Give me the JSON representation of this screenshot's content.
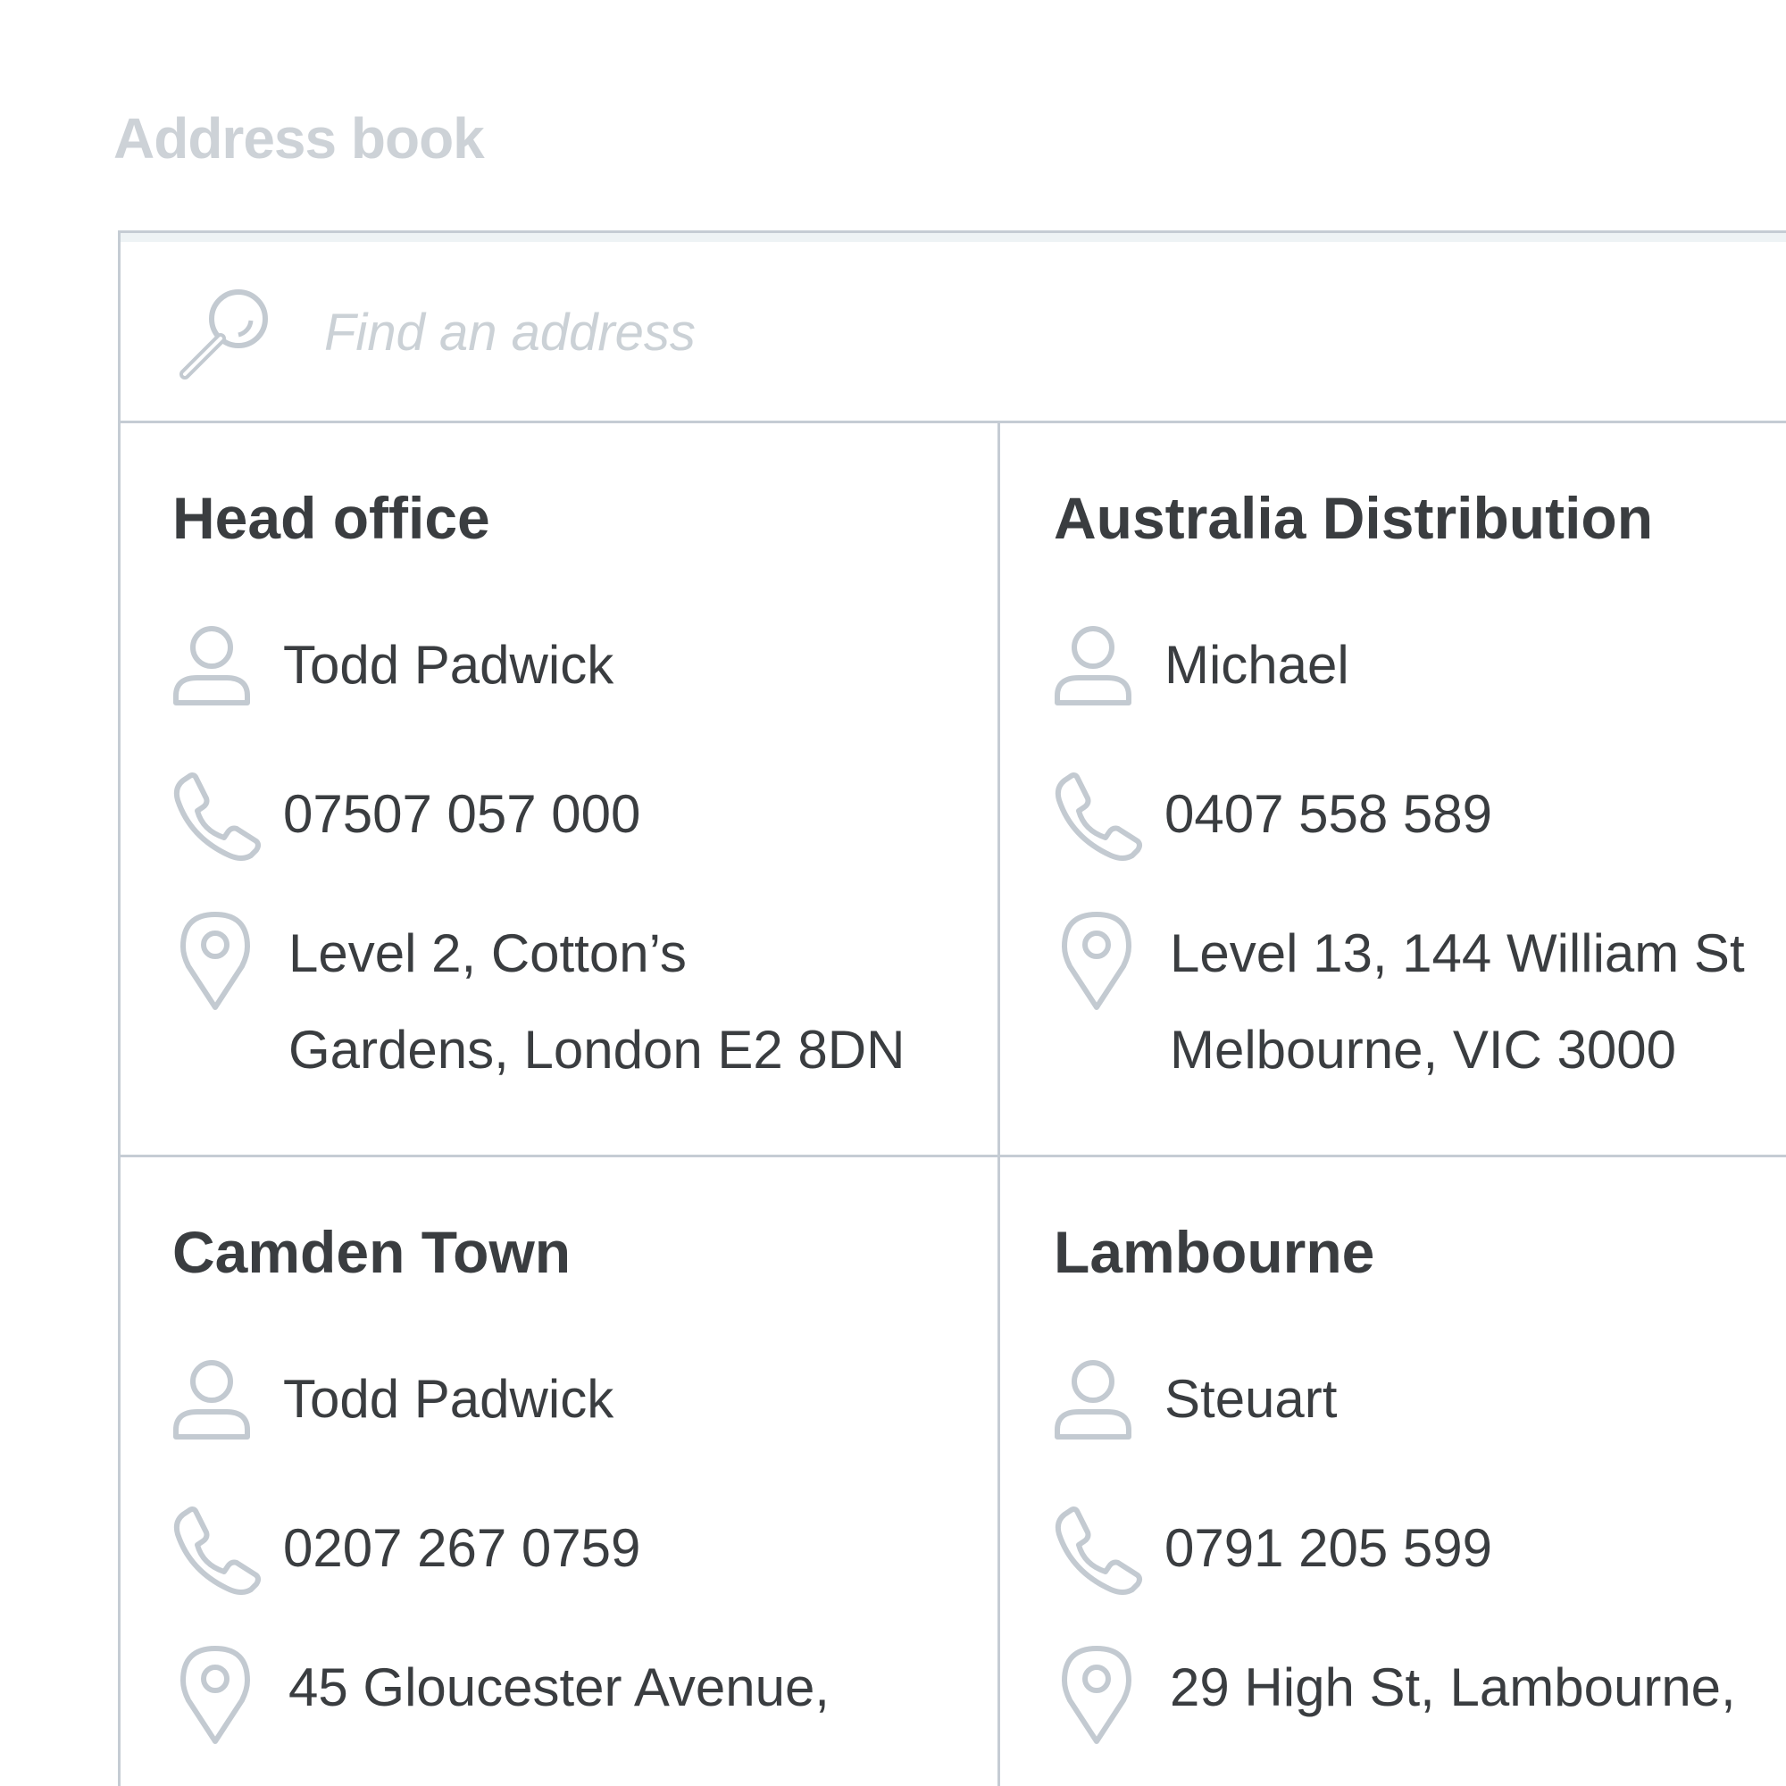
{
  "page": {
    "title": "Address book"
  },
  "search": {
    "placeholder": "Find an address",
    "value": ""
  },
  "addresses": [
    {
      "name": "Head office",
      "contact": "Todd Padwick",
      "phone": "07507 057 000",
      "address_lines": [
        "Level 2, Cotton’s",
        "Gardens, London E2 8DN"
      ]
    },
    {
      "name": "Australia Distribution",
      "contact": "Michael",
      "phone": "0407 558 589",
      "address_lines": [
        "Level 13, 144 William St",
        "Melbourne, VIC 3000"
      ]
    },
    {
      "name": "Camden Town",
      "contact": "Todd Padwick",
      "phone": "0207 267 0759",
      "address_lines": [
        "45 Gloucester Avenue,",
        ""
      ]
    },
    {
      "name": "Lambourne",
      "contact": "Steuart",
      "phone": "0791 205 599",
      "address_lines": [
        "29 High St, Lambourne,",
        ""
      ]
    }
  ],
  "icons": {
    "search": "search-icon",
    "contact": "person-icon",
    "phone": "phone-icon",
    "address": "location-pin-icon"
  },
  "colors": {
    "title": "#cdd2d7",
    "border": "#c5ccd4",
    "icon": "#c3cad1",
    "text": "#3a3d40",
    "placeholder": "#cbd1d6"
  }
}
